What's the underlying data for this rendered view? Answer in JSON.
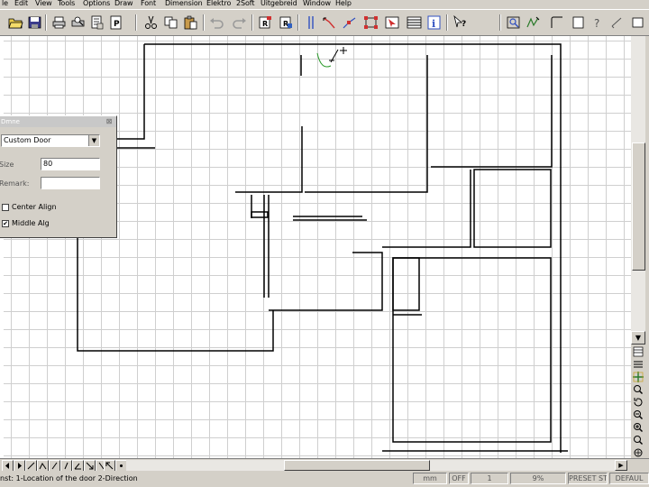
{
  "menu": [
    "le",
    "Edit",
    "View",
    "Tools",
    "Options",
    "Draw",
    "Font",
    "Dimension",
    "Elektro",
    "2Soft",
    "Uitgebreid",
    "Window",
    "Help"
  ],
  "toolbar": {
    "icons": [
      "open-folder-icon",
      "save-icon",
      "print-icon",
      "print-preview-icon",
      "page-setup-icon",
      "page-icon",
      "cut-icon",
      "copy-icon",
      "paste-icon",
      "undo-icon",
      "redo-icon",
      "render-icon",
      "render-region-icon",
      "vertical-lines-icon",
      "arrow-line-icon",
      "node-edit-icon",
      "selection-handles-icon",
      "pointer-icon",
      "list-icon",
      "info-icon",
      "help-pointer-icon",
      "zoom-box-icon",
      "snap-icon",
      "corner-icon",
      "rectangle-icon",
      "question-icon",
      "sketch-icon",
      "box-icon"
    ]
  },
  "door_panel": {
    "title": "Dmne",
    "type_value": "Custom Door",
    "size_label": "Size",
    "size_value": "80",
    "remark_label": "Remark:",
    "remark_value": "",
    "center_align_label": "Center Align",
    "center_align_checked": false,
    "middle_align_label": "Middle Alg",
    "middle_align_checked": true
  },
  "status": {
    "message": "nst: 1-Location of the door  2-Direction",
    "unit": "mm",
    "mode": "OFF",
    "value": "1",
    "zoom": "9%",
    "preset": "PRESET ST",
    "layer": "DEFAUL"
  },
  "colors": {
    "face": "#d4d0c8",
    "canvas": "#ffffff",
    "grid": "#cfcfcf",
    "cursor": "#2a9a2a"
  }
}
